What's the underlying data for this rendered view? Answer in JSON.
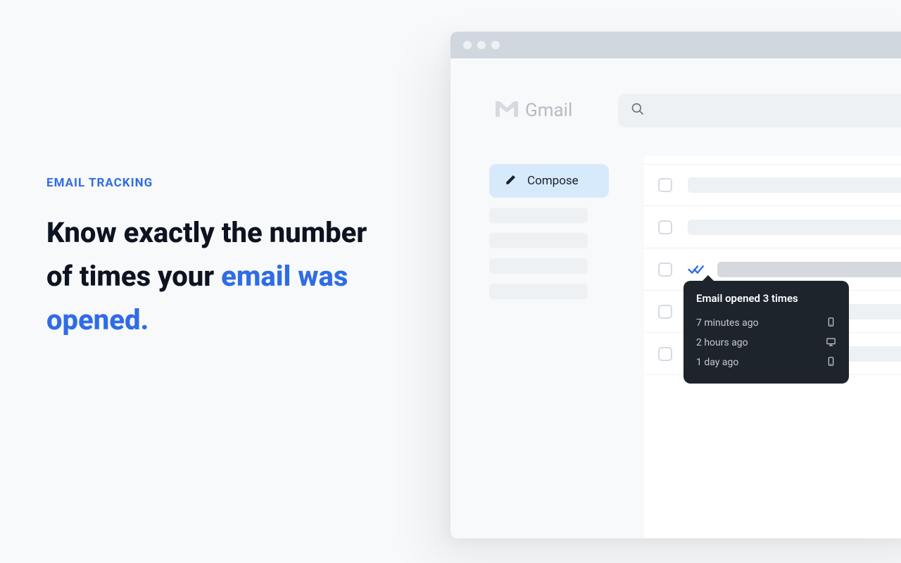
{
  "marketing": {
    "eyebrow": "EMAIL TRACKING",
    "headline_before": "Know exactly the number of times your ",
    "headline_highlight": "email was opened."
  },
  "gmail": {
    "logo_text": "Gmail",
    "compose_label": "Compose"
  },
  "tooltip": {
    "title": "Email opened 3 times",
    "entries": [
      {
        "time": "7 minutes ago",
        "device": "mobile"
      },
      {
        "time": "2 hours ago",
        "device": "desktop"
      },
      {
        "time": "1 day ago",
        "device": "mobile"
      }
    ]
  }
}
